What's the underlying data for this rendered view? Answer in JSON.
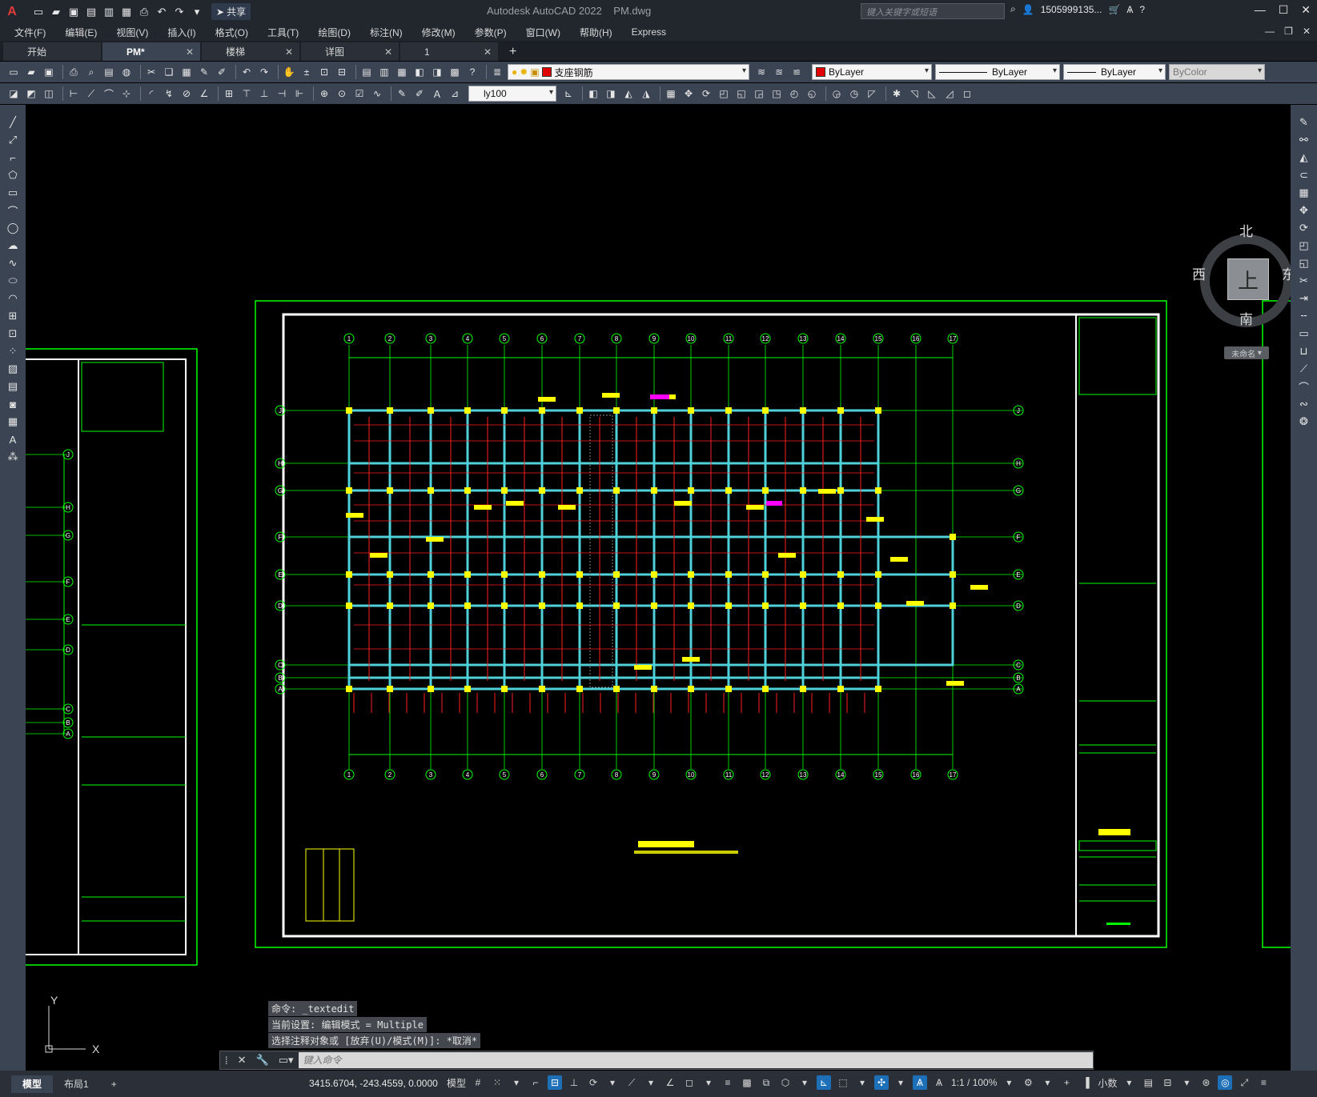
{
  "titlebar": {
    "app_title": "Autodesk AutoCAD 2022",
    "file_name": "PM.dwg",
    "share_label": "共享",
    "search_placeholder": "键入关键字或短语",
    "user_name": "1505999135...",
    "app_logo": "A"
  },
  "menu": {
    "items": [
      "文件(F)",
      "编辑(E)",
      "视图(V)",
      "插入(I)",
      "格式(O)",
      "工具(T)",
      "绘图(D)",
      "标注(N)",
      "修改(M)",
      "参数(P)",
      "窗口(W)",
      "帮助(H)",
      "Express"
    ]
  },
  "tabs": [
    {
      "label": "开始",
      "closable": false
    },
    {
      "label": "PM*",
      "closable": true,
      "active": true
    },
    {
      "label": "楼梯",
      "closable": true
    },
    {
      "label": "详图",
      "closable": true
    },
    {
      "label": "1",
      "closable": true
    }
  ],
  "toolbar": {
    "layer_name": "支座钢筋",
    "color_value": "ByLayer",
    "linetype_value": "ByLayer",
    "lineweight_value": "ByLayer",
    "plotstyle_value": "ByColor",
    "dimstyle_value": "ly100",
    "layer_color": "#e00000"
  },
  "viewcube": {
    "north": "北",
    "south": "南",
    "east": "东",
    "west": "西",
    "face": "上",
    "named_view": "未命名"
  },
  "drawing": {
    "grid_top": [
      "1",
      "2",
      "3",
      "4",
      "5",
      "6",
      "7",
      "8",
      "9",
      "10",
      "11",
      "12",
      "13",
      "14",
      "15",
      "16",
      "17"
    ],
    "grid_side": [
      "J",
      "H",
      "G",
      "F",
      "E",
      "D",
      "C",
      "B",
      "A"
    ],
    "left_sheet_side": [
      "J",
      "H",
      "G",
      "F",
      "E",
      "D",
      "C",
      "B",
      "A"
    ]
  },
  "command": {
    "history": [
      "命令:  _textedit",
      "当前设置: 编辑模式 = Multiple",
      "选择注释对象或 [放弃(U)/模式(M)]: *取消*"
    ],
    "placeholder": "键入命令"
  },
  "ucs": {
    "y_label": "Y",
    "x_label": "X"
  },
  "statusbar": {
    "layouts": [
      "模型",
      "布局1"
    ],
    "coords": "3415.6704, -243.4559, 0.0000",
    "model_label": "模型",
    "scale": "1:1 / 100%",
    "units": "小数"
  },
  "colors": {
    "frame_green": "#00ff00",
    "beam_cyan": "#4fd1d9",
    "rebar_red": "#ff2020",
    "text_yellow": "#ffff00",
    "magenta": "#ff00ff",
    "border_white": "#ffffff"
  }
}
